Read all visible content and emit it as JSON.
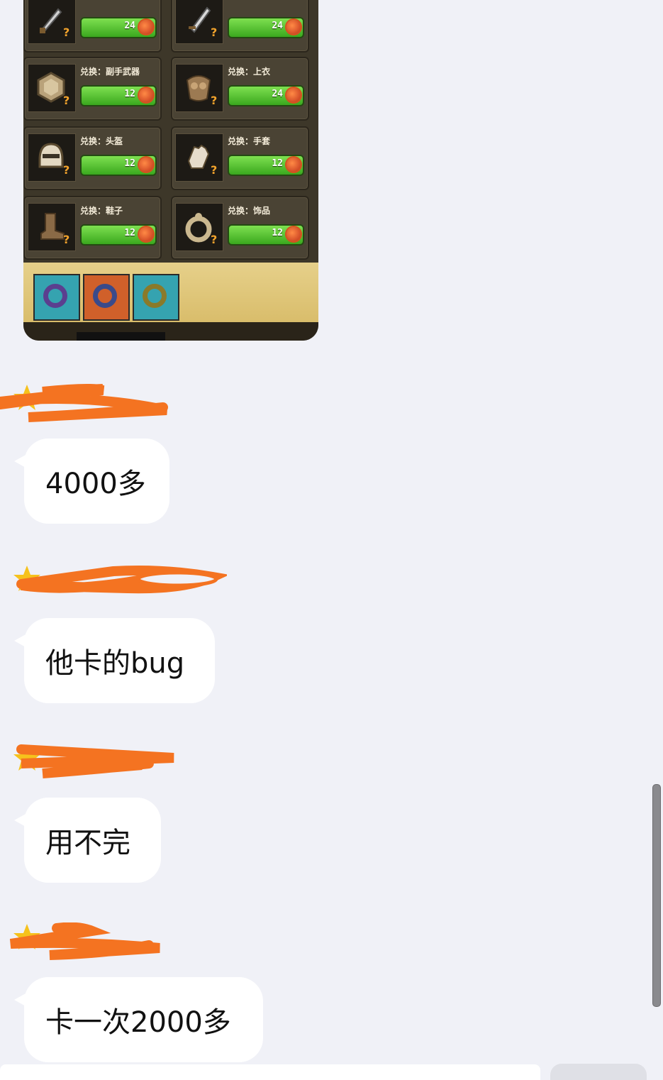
{
  "image_message": {
    "slots": [
      {
        "label": "",
        "cost": "24",
        "icon": "sword-icon"
      },
      {
        "label": "",
        "cost": "24",
        "icon": "sword-icon"
      },
      {
        "label": "兑换：副手武器",
        "cost": "12",
        "icon": "shield-icon"
      },
      {
        "label": "兑换：上衣",
        "cost": "24",
        "icon": "armor-icon"
      },
      {
        "label": "兑换：头盔",
        "cost": "12",
        "icon": "helmet-icon"
      },
      {
        "label": "兑换：手套",
        "cost": "12",
        "icon": "glove-icon"
      },
      {
        "label": "兑换：鞋子",
        "cost": "12",
        "icon": "boot-icon"
      },
      {
        "label": "兑换：饰品",
        "cost": "12",
        "icon": "ring-icon"
      }
    ],
    "question_mark": "?",
    "rings": [
      {
        "icon": "ring-purple-icon",
        "bg": "#35a3b0",
        "band": "#5b3f8f"
      },
      {
        "icon": "ring-orange-icon",
        "bg": "#d0602a",
        "band": "#3a4a8a"
      },
      {
        "icon": "ring-green-icon",
        "bg": "#35a3b0",
        "band": "#8a7a2a"
      }
    ]
  },
  "messages": [
    {
      "text": "4000多"
    },
    {
      "text": "他卡的bug"
    },
    {
      "text": "用不完"
    },
    {
      "text": "卡一次2000多"
    }
  ],
  "colors": {
    "background": "#f0f1f7",
    "bubble": "#ffffff",
    "redaction": "#f47321",
    "star": "#f6c21c"
  }
}
